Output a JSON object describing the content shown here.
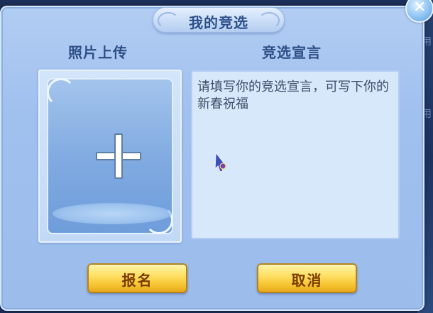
{
  "dialog": {
    "title": "我的竞选",
    "close_icon": "✕"
  },
  "photo_upload": {
    "label": "照片上传",
    "plus_icon": "plus-icon"
  },
  "declaration": {
    "label": "竞选宣言",
    "placeholder": "请填写你的竞选宣言，可写下你的新春祝福"
  },
  "buttons": {
    "register_label": "报名",
    "cancel_label": "取消"
  },
  "colors": {
    "panel": "#a0c0ee",
    "title_text": "#2c4f8a",
    "button_gold": "#ffe066",
    "button_text": "#7a3b00"
  }
}
